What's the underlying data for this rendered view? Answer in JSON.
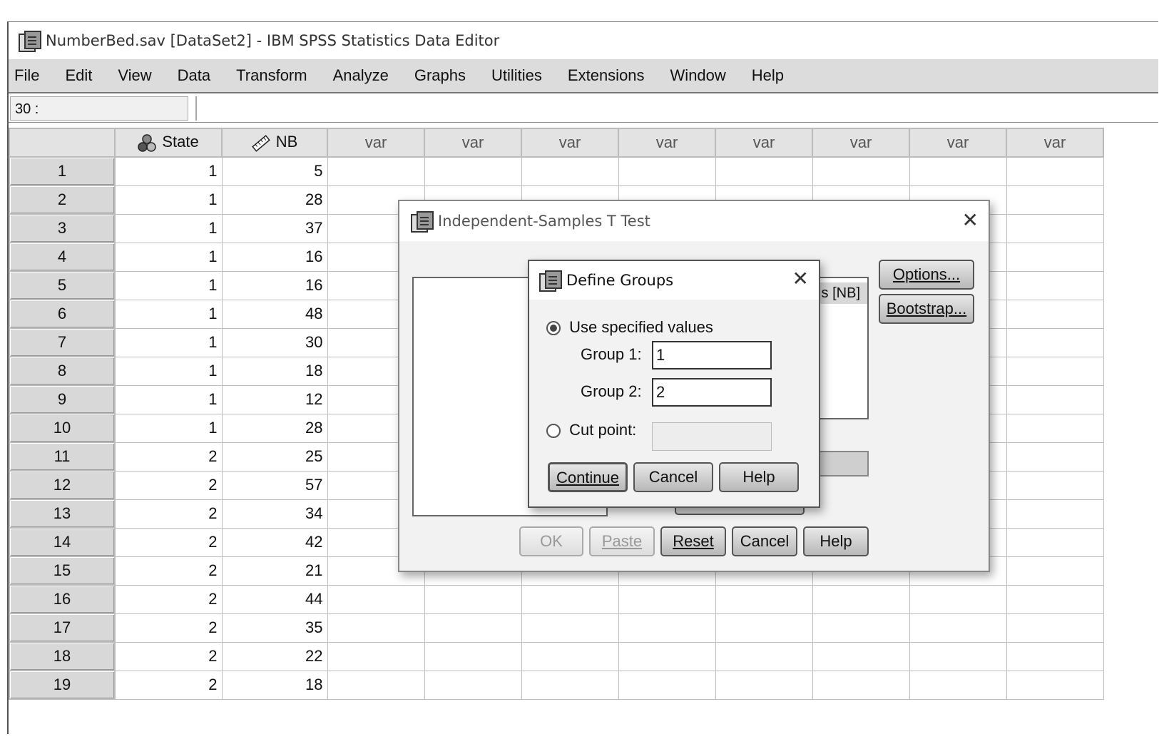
{
  "window": {
    "title": "NumberBed.sav [DataSet2] - IBM SPSS Statistics Data Editor"
  },
  "menu": [
    "File",
    "Edit",
    "View",
    "Data",
    "Transform",
    "Analyze",
    "Graphs",
    "Utilities",
    "Extensions",
    "Window",
    "Help"
  ],
  "cellbar": {
    "ref": "30 :",
    "value": ""
  },
  "columns": {
    "state": "State",
    "nb": "NB",
    "var": "var"
  },
  "rows": [
    {
      "n": "1",
      "state": "1",
      "nb": "5"
    },
    {
      "n": "2",
      "state": "1",
      "nb": "28"
    },
    {
      "n": "3",
      "state": "1",
      "nb": "37"
    },
    {
      "n": "4",
      "state": "1",
      "nb": "16"
    },
    {
      "n": "5",
      "state": "1",
      "nb": "16"
    },
    {
      "n": "6",
      "state": "1",
      "nb": "48"
    },
    {
      "n": "7",
      "state": "1",
      "nb": "30"
    },
    {
      "n": "8",
      "state": "1",
      "nb": "18"
    },
    {
      "n": "9",
      "state": "1",
      "nb": "12"
    },
    {
      "n": "10",
      "state": "1",
      "nb": "28"
    },
    {
      "n": "11",
      "state": "2",
      "nb": "25"
    },
    {
      "n": "12",
      "state": "2",
      "nb": "57"
    },
    {
      "n": "13",
      "state": "2",
      "nb": "34"
    },
    {
      "n": "14",
      "state": "2",
      "nb": "42"
    },
    {
      "n": "15",
      "state": "2",
      "nb": "21"
    },
    {
      "n": "16",
      "state": "2",
      "nb": "44"
    },
    {
      "n": "17",
      "state": "2",
      "nb": "35"
    },
    {
      "n": "18",
      "state": "2",
      "nb": "22"
    },
    {
      "n": "19",
      "state": "2",
      "nb": "18"
    }
  ],
  "ttest": {
    "title": "Independent-Samples T Test",
    "test_var_visible": "s [NB]",
    "options": "Options...",
    "bootstrap": "Bootstrap...",
    "ok": "OK",
    "paste": "Paste",
    "reset": "Reset",
    "cancel": "Cancel",
    "help": "Help"
  },
  "define": {
    "title": "Define Groups",
    "use_specified": "Use specified values",
    "group1_label": "Group 1:",
    "group1_value": "1",
    "group2_label": "Group 2:",
    "group2_value": "2",
    "cut_point": "Cut point:",
    "cut_value": "",
    "continue": "Continue",
    "cancel": "Cancel",
    "help": "Help"
  }
}
